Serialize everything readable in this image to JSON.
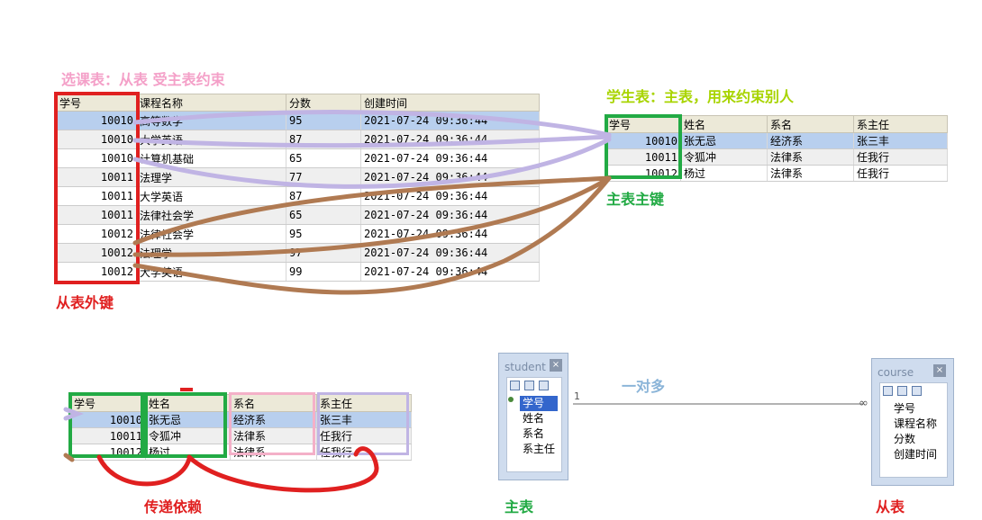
{
  "annotations": {
    "course_title": "选课表：从表  受主表约束",
    "student_title": "学生表：主表，用来约束别人",
    "pk_label": "主表主键",
    "fk_label": "从表外键",
    "transitive_label": "传递依赖",
    "one_to_many": "一对多",
    "master_label": "主表",
    "slave_label": "从表"
  },
  "colors": {
    "title_pink": "#f4a0c8",
    "title_lime": "#a8d400",
    "green": "#22aa44",
    "red": "#e02020",
    "lavender": "#c0b4e4",
    "brown": "#b07a52",
    "pink_box": "#f4b0c8",
    "blue_text": "#8ab4d8"
  },
  "course_table": {
    "headers": [
      "学号",
      "课程名称",
      "分数",
      "创建时间"
    ],
    "rows": [
      [
        "10010",
        "高等数学",
        "95",
        "2021-07-24 09:36:44"
      ],
      [
        "10010",
        "大学英语",
        "87",
        "2021-07-24 09:36:44"
      ],
      [
        "10010",
        "计算机基础",
        "65",
        "2021-07-24 09:36:44"
      ],
      [
        "10011",
        "法理学",
        "77",
        "2021-07-24 09:36:44"
      ],
      [
        "10011",
        "大学英语",
        "87",
        "2021-07-24 09:36:44"
      ],
      [
        "10011",
        "法律社会学",
        "65",
        "2021-07-24 09:36:44"
      ],
      [
        "10012",
        "法律社会学",
        "95",
        "2021-07-24 09:36:44"
      ],
      [
        "10012",
        "法理学",
        "97",
        "2021-07-24 09:36:44"
      ],
      [
        "10012",
        "大学英语",
        "99",
        "2021-07-24 09:36:44"
      ]
    ]
  },
  "student_table": {
    "headers": [
      "学号",
      "姓名",
      "系名",
      "系主任"
    ],
    "rows": [
      [
        "10010",
        "张无忌",
        "经济系",
        "张三丰"
      ],
      [
        "10011",
        "令狐冲",
        "法律系",
        "任我行"
      ],
      [
        "10012",
        "杨过",
        "法律系",
        "任我行"
      ]
    ]
  },
  "entity_student": {
    "title": "student",
    "close": "×",
    "fields": [
      "学号",
      "姓名",
      "系名",
      "系主任"
    ],
    "cardinality": "1"
  },
  "entity_course": {
    "title": "course",
    "close": "×",
    "fields": [
      "学号",
      "课程名称",
      "分数",
      "创建时间"
    ],
    "cardinality": "∞"
  }
}
